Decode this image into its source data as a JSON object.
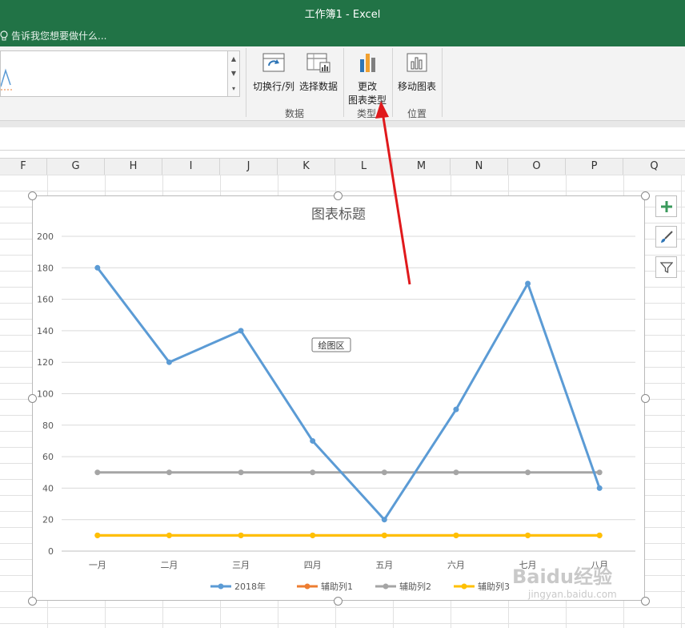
{
  "window": {
    "title": "工作簿1 - Excel"
  },
  "tell_me": {
    "placeholder": "告诉我您想要做什么..."
  },
  "ribbon": {
    "buttons": {
      "switch_row_col": "切换行/列",
      "select_data": "选择数据",
      "change_type_line1": "更改",
      "change_type_line2": "图表类型",
      "move_chart": "移动图表"
    },
    "groups": {
      "data": "数据",
      "type": "类型",
      "location": "位置"
    }
  },
  "columns": [
    "F",
    "G",
    "H",
    "I",
    "J",
    "K",
    "L",
    "M",
    "N",
    "O",
    "P",
    "Q"
  ],
  "colors": {
    "excel_green": "#217346",
    "series1": "#5B9BD5",
    "series2": "#ED7D31",
    "series3": "#A5A5A5",
    "series4": "#FFC000",
    "arrow": "#E0191C"
  },
  "plot_area_tooltip": "绘图区",
  "watermark": {
    "brand": "Baidu经验",
    "url": "jingyan.baidu.com"
  },
  "chart_data": {
    "type": "line",
    "title": "图表标题",
    "categories": [
      "一月",
      "二月",
      "三月",
      "四月",
      "五月",
      "六月",
      "七月",
      "八月"
    ],
    "ylim": [
      0,
      200
    ],
    "yticks": [
      0,
      20,
      40,
      60,
      80,
      100,
      120,
      140,
      160,
      180,
      200
    ],
    "grid": true,
    "legend": "bottom",
    "series": [
      {
        "name": "2018年",
        "color": "#5B9BD5",
        "values": [
          180,
          120,
          140,
          70,
          20,
          90,
          170,
          40
        ]
      },
      {
        "name": "辅助列1",
        "color": "#ED7D31",
        "values": [
          10,
          10,
          10,
          10,
          10,
          10,
          10,
          10
        ]
      },
      {
        "name": "辅助列2",
        "color": "#A5A5A5",
        "values": [
          50,
          50,
          50,
          50,
          50,
          50,
          50,
          50
        ]
      },
      {
        "name": "辅助列3",
        "color": "#FFC000",
        "values": [
          10,
          10,
          10,
          10,
          10,
          10,
          10,
          10
        ]
      }
    ]
  }
}
